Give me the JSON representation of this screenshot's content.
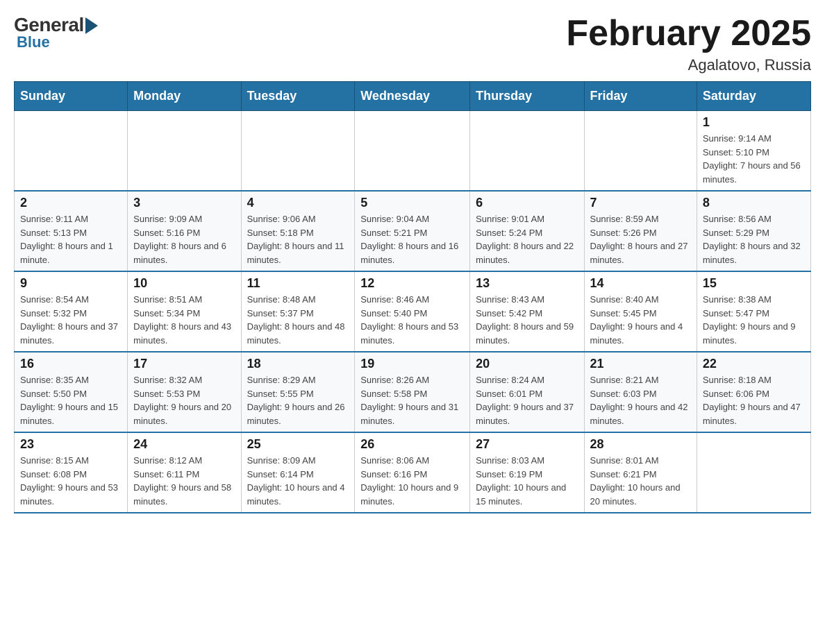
{
  "logo": {
    "general": "General",
    "blue": "Blue"
  },
  "header": {
    "month_title": "February 2025",
    "location": "Agalatovo, Russia"
  },
  "days_of_week": [
    "Sunday",
    "Monday",
    "Tuesday",
    "Wednesday",
    "Thursday",
    "Friday",
    "Saturday"
  ],
  "weeks": [
    [
      {
        "day": "",
        "info": ""
      },
      {
        "day": "",
        "info": ""
      },
      {
        "day": "",
        "info": ""
      },
      {
        "day": "",
        "info": ""
      },
      {
        "day": "",
        "info": ""
      },
      {
        "day": "",
        "info": ""
      },
      {
        "day": "1",
        "info": "Sunrise: 9:14 AM\nSunset: 5:10 PM\nDaylight: 7 hours and 56 minutes."
      }
    ],
    [
      {
        "day": "2",
        "info": "Sunrise: 9:11 AM\nSunset: 5:13 PM\nDaylight: 8 hours and 1 minute."
      },
      {
        "day": "3",
        "info": "Sunrise: 9:09 AM\nSunset: 5:16 PM\nDaylight: 8 hours and 6 minutes."
      },
      {
        "day": "4",
        "info": "Sunrise: 9:06 AM\nSunset: 5:18 PM\nDaylight: 8 hours and 11 minutes."
      },
      {
        "day": "5",
        "info": "Sunrise: 9:04 AM\nSunset: 5:21 PM\nDaylight: 8 hours and 16 minutes."
      },
      {
        "day": "6",
        "info": "Sunrise: 9:01 AM\nSunset: 5:24 PM\nDaylight: 8 hours and 22 minutes."
      },
      {
        "day": "7",
        "info": "Sunrise: 8:59 AM\nSunset: 5:26 PM\nDaylight: 8 hours and 27 minutes."
      },
      {
        "day": "8",
        "info": "Sunrise: 8:56 AM\nSunset: 5:29 PM\nDaylight: 8 hours and 32 minutes."
      }
    ],
    [
      {
        "day": "9",
        "info": "Sunrise: 8:54 AM\nSunset: 5:32 PM\nDaylight: 8 hours and 37 minutes."
      },
      {
        "day": "10",
        "info": "Sunrise: 8:51 AM\nSunset: 5:34 PM\nDaylight: 8 hours and 43 minutes."
      },
      {
        "day": "11",
        "info": "Sunrise: 8:48 AM\nSunset: 5:37 PM\nDaylight: 8 hours and 48 minutes."
      },
      {
        "day": "12",
        "info": "Sunrise: 8:46 AM\nSunset: 5:40 PM\nDaylight: 8 hours and 53 minutes."
      },
      {
        "day": "13",
        "info": "Sunrise: 8:43 AM\nSunset: 5:42 PM\nDaylight: 8 hours and 59 minutes."
      },
      {
        "day": "14",
        "info": "Sunrise: 8:40 AM\nSunset: 5:45 PM\nDaylight: 9 hours and 4 minutes."
      },
      {
        "day": "15",
        "info": "Sunrise: 8:38 AM\nSunset: 5:47 PM\nDaylight: 9 hours and 9 minutes."
      }
    ],
    [
      {
        "day": "16",
        "info": "Sunrise: 8:35 AM\nSunset: 5:50 PM\nDaylight: 9 hours and 15 minutes."
      },
      {
        "day": "17",
        "info": "Sunrise: 8:32 AM\nSunset: 5:53 PM\nDaylight: 9 hours and 20 minutes."
      },
      {
        "day": "18",
        "info": "Sunrise: 8:29 AM\nSunset: 5:55 PM\nDaylight: 9 hours and 26 minutes."
      },
      {
        "day": "19",
        "info": "Sunrise: 8:26 AM\nSunset: 5:58 PM\nDaylight: 9 hours and 31 minutes."
      },
      {
        "day": "20",
        "info": "Sunrise: 8:24 AM\nSunset: 6:01 PM\nDaylight: 9 hours and 37 minutes."
      },
      {
        "day": "21",
        "info": "Sunrise: 8:21 AM\nSunset: 6:03 PM\nDaylight: 9 hours and 42 minutes."
      },
      {
        "day": "22",
        "info": "Sunrise: 8:18 AM\nSunset: 6:06 PM\nDaylight: 9 hours and 47 minutes."
      }
    ],
    [
      {
        "day": "23",
        "info": "Sunrise: 8:15 AM\nSunset: 6:08 PM\nDaylight: 9 hours and 53 minutes."
      },
      {
        "day": "24",
        "info": "Sunrise: 8:12 AM\nSunset: 6:11 PM\nDaylight: 9 hours and 58 minutes."
      },
      {
        "day": "25",
        "info": "Sunrise: 8:09 AM\nSunset: 6:14 PM\nDaylight: 10 hours and 4 minutes."
      },
      {
        "day": "26",
        "info": "Sunrise: 8:06 AM\nSunset: 6:16 PM\nDaylight: 10 hours and 9 minutes."
      },
      {
        "day": "27",
        "info": "Sunrise: 8:03 AM\nSunset: 6:19 PM\nDaylight: 10 hours and 15 minutes."
      },
      {
        "day": "28",
        "info": "Sunrise: 8:01 AM\nSunset: 6:21 PM\nDaylight: 10 hours and 20 minutes."
      },
      {
        "day": "",
        "info": ""
      }
    ]
  ]
}
